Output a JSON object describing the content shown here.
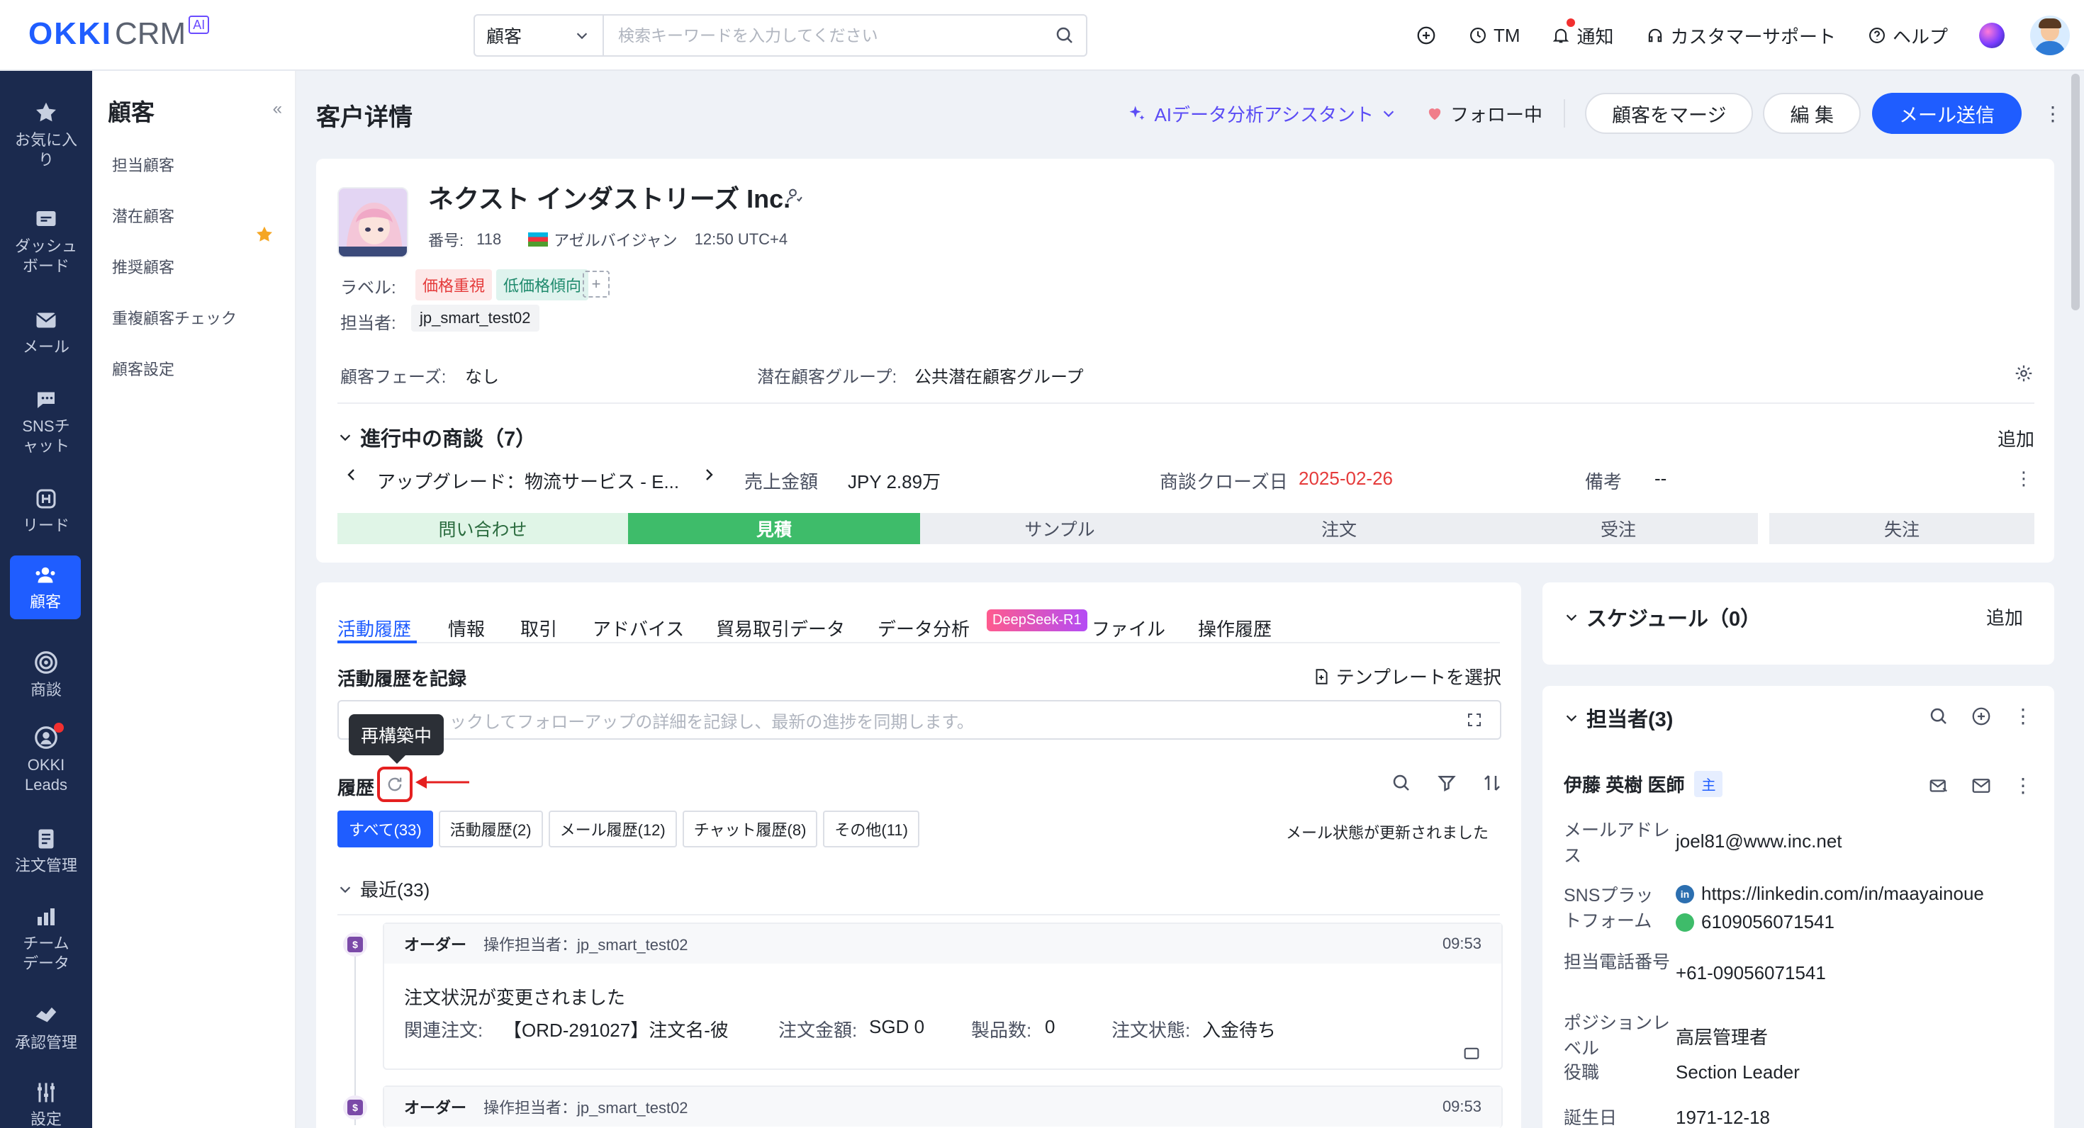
{
  "topbar": {
    "logo_okki": "OKKI",
    "logo_crm": "CRM",
    "logo_ai": "AI",
    "search_scope": "顧客",
    "search_placeholder": "検索キーワードを入力してください",
    "tm": "TM",
    "notify": "通知",
    "support": "カスタマーサポート",
    "help": "ヘルプ"
  },
  "leftnav": {
    "items": [
      {
        "label": "お気に入り",
        "icon": "star-icon"
      },
      {
        "label": "ダッシュボード",
        "icon": "dashboard-icon"
      },
      {
        "label": "メール",
        "icon": "mail-icon"
      },
      {
        "label": "SNSチャット",
        "icon": "chat-icon"
      },
      {
        "label": "リード",
        "icon": "lead-icon"
      },
      {
        "label": "顧客",
        "icon": "customer-icon"
      },
      {
        "label": "商談",
        "icon": "target-icon"
      },
      {
        "label": "OKKI Leads",
        "icon": "leads-icon"
      },
      {
        "label": "注文管理",
        "icon": "order-icon"
      },
      {
        "label": "チームデータ",
        "icon": "chart-icon"
      },
      {
        "label": "承認管理",
        "icon": "approve-icon"
      },
      {
        "label": "設定",
        "icon": "settings-icon"
      }
    ]
  },
  "subnav": {
    "title": "顧客",
    "collapse": "«",
    "items": [
      "担当顧客",
      "潜在顧客",
      "推奨顧客",
      "重複顧客チェック",
      "顧客設定"
    ]
  },
  "header": {
    "title": "客户详情",
    "ai_assistant": "AIデータ分析アシスタント",
    "follow": "フォロー中",
    "merge": "顧客をマージ",
    "edit": "編 集",
    "send_mail": "メール送信"
  },
  "customer": {
    "name": "ネクスト インダストリーズ Inc.",
    "number_label": "番号:",
    "number": "118",
    "country": "アゼルバイジャン",
    "local_time": "12:50 UTC+4",
    "label_title": "ラベル:",
    "tags": [
      "価格重視",
      "低価格傾向"
    ],
    "owner_label": "担当者:",
    "owner": "jp_smart_test02",
    "phase_label": "顧客フェーズ:",
    "phase": "なし",
    "group_label": "潜在顧客グループ:",
    "group": "公共潜在顧客グループ"
  },
  "deals": {
    "title": "進行中の商談（7）",
    "add": "追加",
    "current_deal": "アップグレード：物流サービス - E...",
    "amount_label": "売上金額",
    "amount": "JPY 2.89万",
    "close_label": "商談クローズ日",
    "close_date": "2025-02-26",
    "note_label": "備考",
    "note": "--",
    "stages": [
      "問い合わせ",
      "見積",
      "サンプル",
      "注文",
      "受注",
      "失注"
    ]
  },
  "activity": {
    "tabs": [
      "活動履歴",
      "情報",
      "取引",
      "アドバイス",
      "貿易取引データ",
      "データ分析",
      "ファイル",
      "操作履歴"
    ],
    "deepseek_badge": "DeepSeek-R1",
    "record_title": "活動履歴を記録",
    "template": "テンプレートを選択",
    "record_placeholder": "ックしてフォローアップの詳細を記録し、最新の進捗を同期します。",
    "tooltip": "再構築中",
    "history_title": "履歴",
    "filters": [
      "すべて(33)",
      "活動履歴(2)",
      "メール履歴(12)",
      "チャット履歴(8)",
      "その他(11)"
    ],
    "status": "メール状態が更新されました",
    "recent": "最近(33)",
    "entries": [
      {
        "type": "オーダー",
        "operator": "操作担当者：jp_smart_test02",
        "time": "09:53",
        "title": "注文状況が変更されました",
        "related_label": "関連注文:",
        "related": "【ORD-291027】注文名-彼",
        "amount_label": "注文金額:",
        "amount": "SGD 0",
        "count_label": "製品数:",
        "count": "0",
        "state_label": "注文状態:",
        "state": "入金待ち"
      },
      {
        "type": "オーダー",
        "operator": "操作担当者：jp_smart_test02",
        "time": "09:53"
      }
    ]
  },
  "schedule": {
    "title": "スケジュール（0）",
    "add": "追加"
  },
  "owners": {
    "title": "担当者(3)",
    "contact_name": "伊藤 英樹 医師",
    "main_badge": "主",
    "fields": {
      "email_label": "メールアドレス",
      "email": "joel81@www.inc.net",
      "sns_label": "SNSプラットフォーム",
      "linkedin": "https://linkedin.com/in/maayainoue",
      "whatsapp": "6109056071541",
      "phone_label": "担当電話番号",
      "phone": "+61-09056071541",
      "level_label": "ポジションレベル",
      "level": "高层管理者",
      "role_label": "役職",
      "role": "Section Leader",
      "birthday_label": "誕生日",
      "birthday": "1971-12-18"
    }
  },
  "colors": {
    "primary": "#1f5dff",
    "nav_bg": "#1b2a4e",
    "stage_current": "#3ebc6a",
    "alert": "#e52020"
  }
}
